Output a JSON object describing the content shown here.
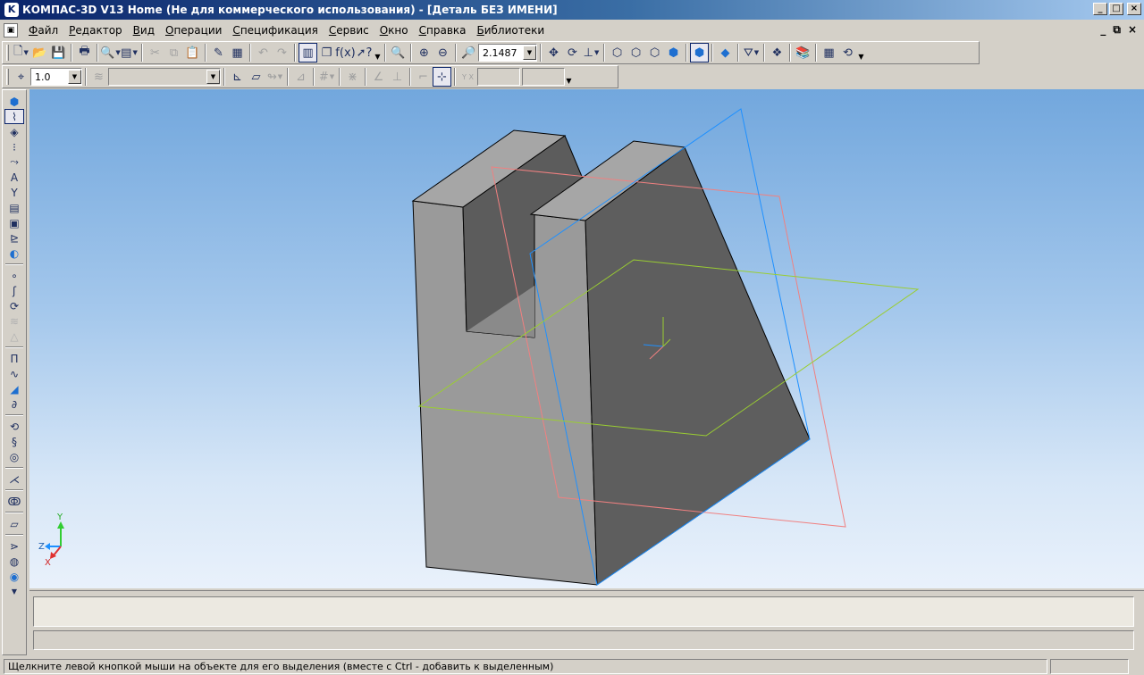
{
  "window": {
    "title": "КОМПАС-3D V13 Home (Не для коммерческого использования) - [Деталь БЕЗ ИМЕНИ]",
    "icon": "kompas-logo-icon",
    "controls": {
      "minimize": "_",
      "maximize": "□",
      "close": "×"
    }
  },
  "menu": {
    "items": [
      {
        "label": "Файл",
        "key": "Ф",
        "rest": "айл"
      },
      {
        "label": "Редактор",
        "key": "Р",
        "rest": "едактор"
      },
      {
        "label": "Вид",
        "key": "В",
        "rest": "ид"
      },
      {
        "label": "Операции",
        "key": "О",
        "rest": "перации"
      },
      {
        "label": "Спецификация",
        "key": "С",
        "rest": "пецификация"
      },
      {
        "label": "Сервис",
        "key": "С",
        "rest": "ервис"
      },
      {
        "label": "Окно",
        "key": "О",
        "rest": "кно"
      },
      {
        "label": "Справка",
        "key": "С",
        "rest": "правка"
      },
      {
        "label": "Библиотеки",
        "key": "Б",
        "rest": "иблиотеки"
      }
    ],
    "mdi_controls": {
      "minimize": "_",
      "restore": "⧉",
      "close": "×"
    }
  },
  "toolbar_standard": {
    "zoom_value": "2.1487",
    "function_label": "f(x)"
  },
  "toolbar_current_state": {
    "step_value": "1.0",
    "coord_label": "Y X"
  },
  "viewport": {
    "colors": {
      "face_front": "#9a9a9a",
      "face_side": "#5e5e5e",
      "face_top": "#a6a6a6",
      "plane_xy": "#f08080",
      "plane_zy": "#1e90ff",
      "plane_zx": "#9acd32"
    },
    "triad": {
      "y_label": "Y",
      "z_label": "Z",
      "x_label": "X"
    }
  },
  "status": {
    "text": "Щелкните левой кнопкой мыши на объекте для его выделения (вместе с Ctrl - добавить к выделенным)"
  }
}
